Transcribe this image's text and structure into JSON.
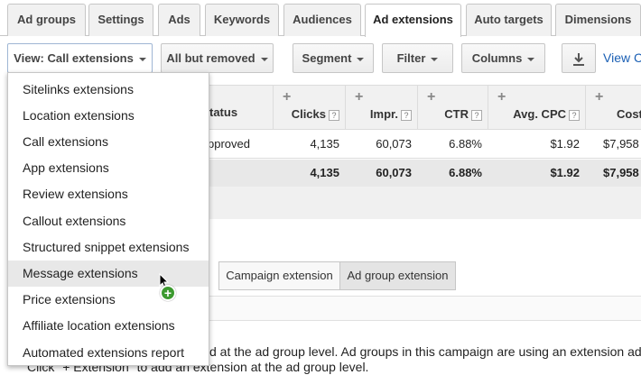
{
  "tabs": [
    "Ad groups",
    "Settings",
    "Ads",
    "Keywords",
    "Audiences",
    "Ad extensions",
    "Auto targets",
    "Dimensions"
  ],
  "toolbar": {
    "view_label": "View: Call extensions",
    "filter_removed_label": "All but removed",
    "segment_label": "Segment",
    "filter_label": "Filter",
    "columns_label": "Columns",
    "view_link": "View C"
  },
  "table": {
    "status_header": "tatus",
    "columns": [
      {
        "label": "Clicks",
        "help": "?"
      },
      {
        "label": "Impr.",
        "help": "?"
      },
      {
        "label": "CTR",
        "help": "?"
      },
      {
        "label": "Avg. CPC",
        "help": "?"
      },
      {
        "label": "Cost",
        "help": ""
      }
    ],
    "rows": [
      {
        "status": "pproved",
        "values": [
          "4,135",
          "60,073",
          "6.88%",
          "$1.92",
          "$7,958"
        ]
      }
    ],
    "total": {
      "values": [
        "4,135",
        "60,073",
        "6.88%",
        "$1.92",
        "$7,958"
      ]
    }
  },
  "level_toggle": {
    "campaign": "Campaign extension",
    "adgroup": "Ad group extension"
  },
  "info_text": {
    "line1": "d at the ad group level. Ad groups in this campaign are using an extension added",
    "line2": "Click \"+ Extension\" to add an extension at the ad group level."
  },
  "dropdown": {
    "items": [
      "Sitelinks extensions",
      "Location extensions",
      "Call extensions",
      "App extensions",
      "Review extensions",
      "Callout extensions",
      "Structured snippet extensions",
      "Message extensions",
      "Price extensions",
      "Affiliate location extensions",
      "Automated extensions report"
    ],
    "hovered_index": 7
  },
  "plus_sign": "+",
  "colors": {
    "accent_link": "#1a5fb4",
    "add_badge": "#3c9a2f",
    "hover_bg": "#e8e8e8"
  }
}
